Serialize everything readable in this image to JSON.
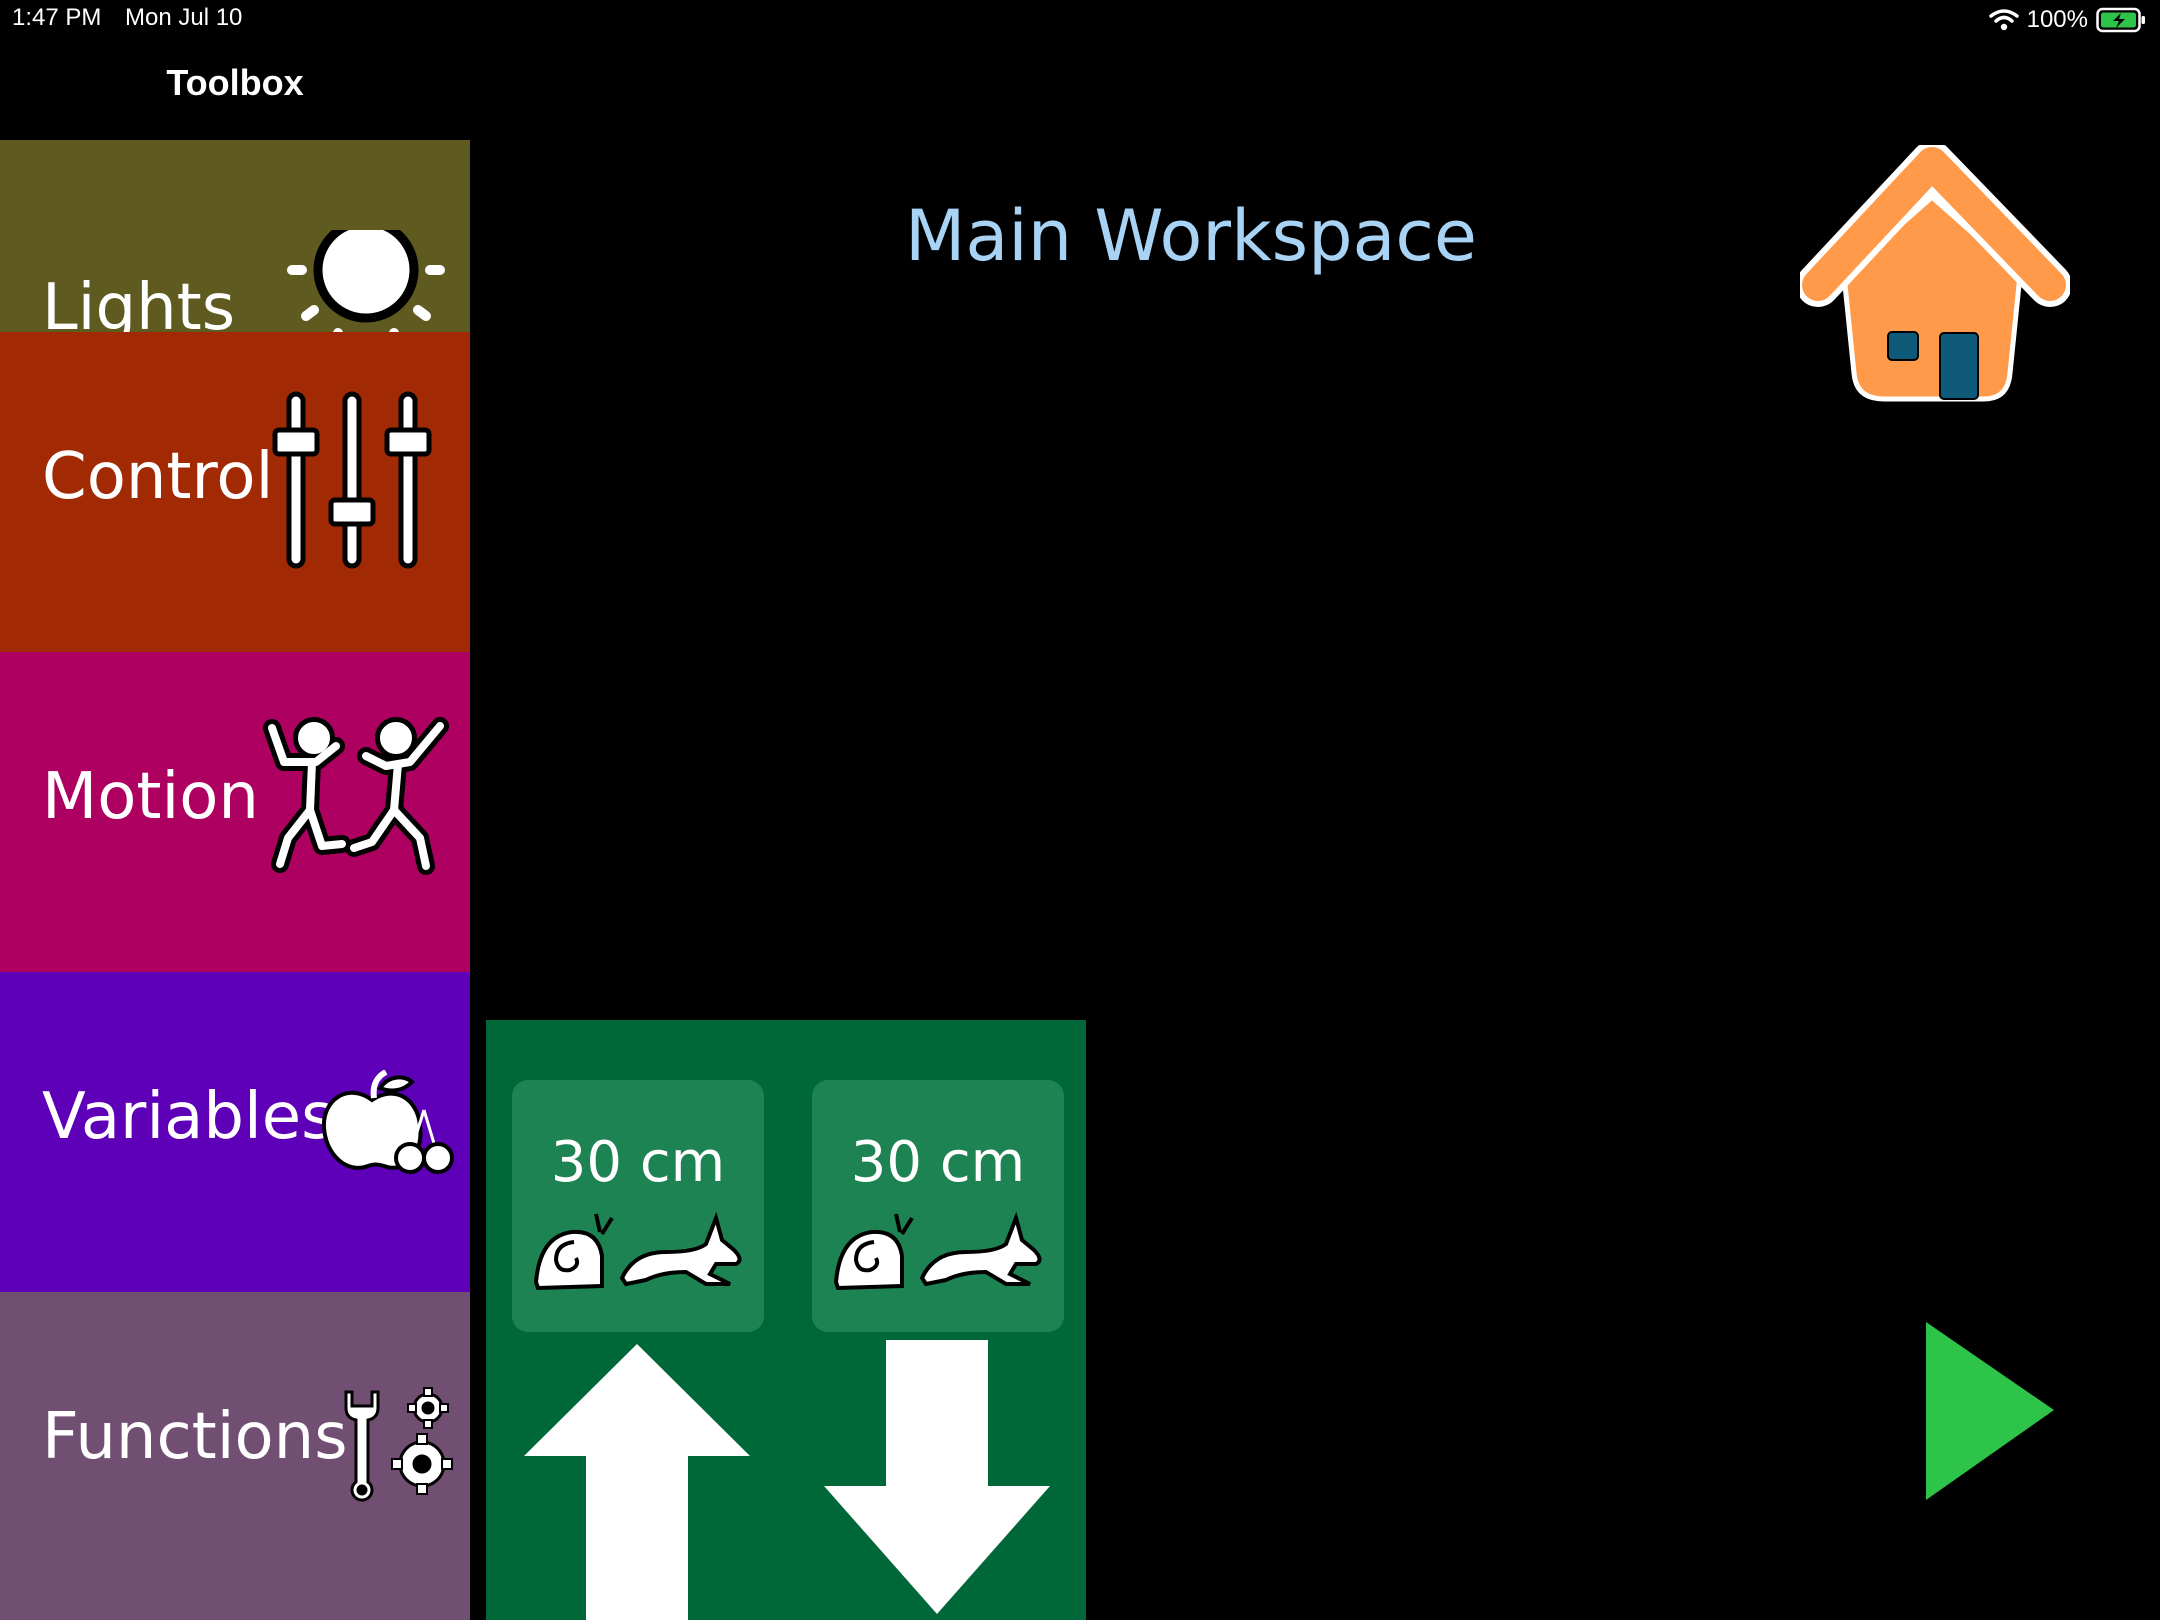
{
  "status_bar": {
    "time": "1:47 PM",
    "date": "Mon Jul 10",
    "battery": "100%"
  },
  "toolbox": {
    "title": "Toolbox",
    "categories": [
      {
        "label": "Lights",
        "color": "#5f5a1f",
        "icon": "sun-icon"
      },
      {
        "label": "Control",
        "color": "#a12a05",
        "icon": "sliders-icon"
      },
      {
        "label": "Motion",
        "color": "#ad0060",
        "icon": "dancers-icon"
      },
      {
        "label": "Variables",
        "color": "#5d00b8",
        "icon": "apple-cherries-icon"
      },
      {
        "label": "Functions",
        "color": "#714f72",
        "icon": "wrench-gears-icon"
      }
    ]
  },
  "workspace": {
    "title": "Main Workspace"
  },
  "block": {
    "color": "#006838",
    "params": [
      {
        "value": "30 cm",
        "icon": "snail-rabbit-speed-icon"
      },
      {
        "value": "30 cm",
        "icon": "snail-rabbit-speed-icon"
      }
    ],
    "arrows": [
      "up-arrow-icon",
      "down-arrow-icon"
    ]
  },
  "colors": {
    "home": "#ff9a4a",
    "play": "#2ec44a",
    "title": "#a8d3f5"
  }
}
